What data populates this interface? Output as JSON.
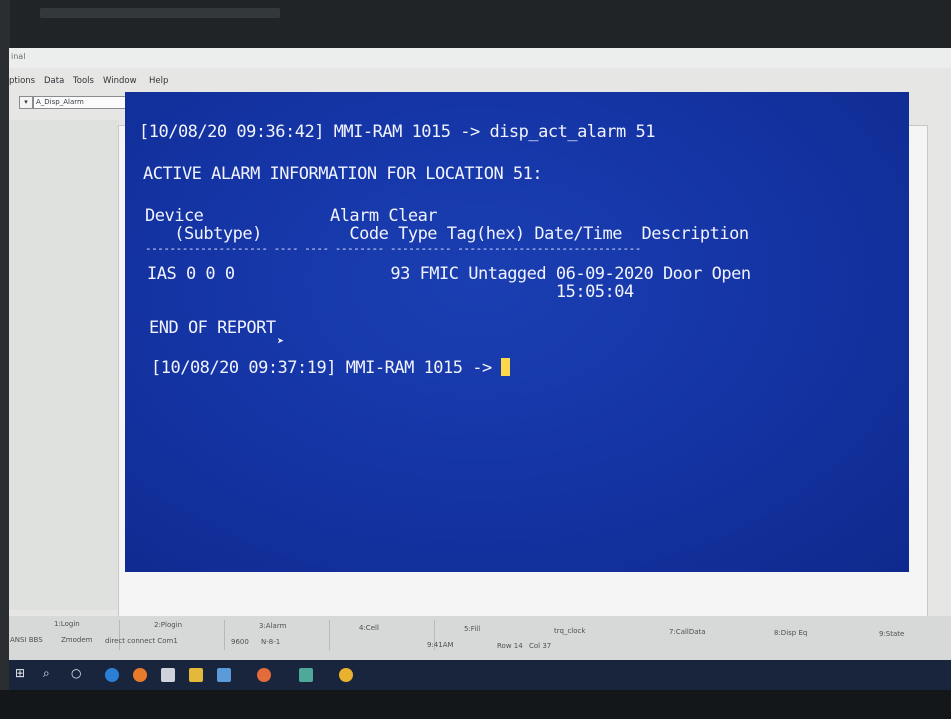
{
  "window": {
    "title": "inal"
  },
  "menu": [
    "ptions",
    "Data",
    "Tools",
    "Window",
    "Help"
  ],
  "toolbar": {
    "window_select": "A_Disp_Alarm"
  },
  "terminal": {
    "line1": "[10/08/20 09:36:42] MMI-RAM 1015 -> disp_act_alarm 51",
    "line2": "ACTIVE ALARM INFORMATION FOR LOCATION 51:",
    "hdr1": "Device             Alarm Clear",
    "hdr2": "   (Subtype)         Code Type Tag(hex) Date/Time  Description",
    "hdr3": "-------------------- ---- ---- -------- ---------- ------------------------------",
    "row1": "IAS 0 0 0                93 FMIC Untagged 06-09-2020 Door Open",
    "row2": "                                          15:05:04",
    "end": "END OF REPORT",
    "prompt": "[10/08/20 09:37:19] MMI-RAM 1015 -> "
  },
  "status": {
    "f1": "1:Login",
    "f2": "2:Plogin",
    "f3": "3:Alarm",
    "f4": "4:Cell",
    "f5": "5:Fill",
    "f6": "trq_clock",
    "f7": "7:CallData",
    "f8": "8:Disp Eq",
    "f9": "9:State",
    "b1": "ANSI BBS",
    "b2": "Zmodem",
    "b3": "direct connect Com1",
    "b4": "9600",
    "b5": "N-8-1",
    "b6": "9:41AM",
    "b7": "Row 14",
    "b8": "Col 37"
  },
  "colors": {
    "terminal_bg": "#1535a6",
    "terminal_fg": "#f1f3ff",
    "cursor": "#ffd84a",
    "taskbar": "#18253c"
  }
}
